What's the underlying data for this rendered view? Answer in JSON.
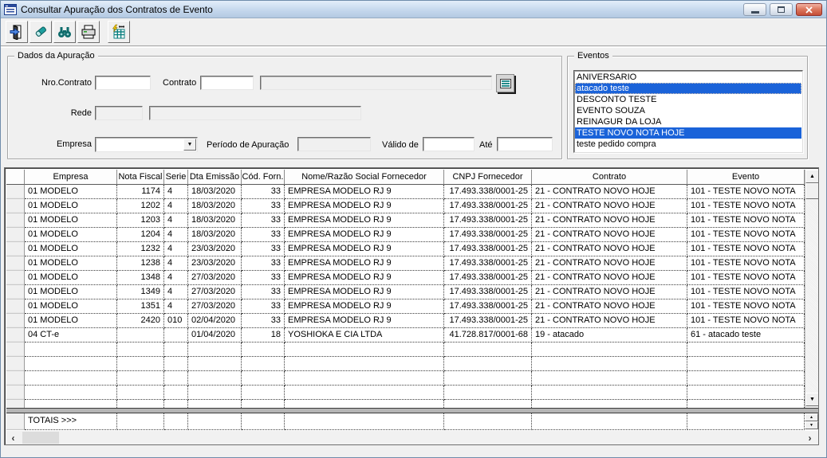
{
  "window": {
    "title": "Consultar Apuração dos Contratos de Evento",
    "controls": [
      "minimize",
      "restore",
      "close"
    ]
  },
  "toolbar": {
    "buttons": [
      {
        "name": "exit",
        "icon": "exit-door-icon"
      },
      {
        "name": "clear",
        "icon": "eraser-icon"
      },
      {
        "name": "search",
        "icon": "binoculars-icon"
      },
      {
        "name": "print",
        "icon": "printer-icon"
      },
      {
        "name": "apurar",
        "icon": "grid-lightning-icon"
      }
    ]
  },
  "filters": {
    "title": "Dados da Apuração",
    "fields": {
      "nro_contrato": {
        "label": "Nro.Contrato",
        "value": ""
      },
      "contrato_cod": {
        "label": "Contrato",
        "value": ""
      },
      "contrato_desc": {
        "value": ""
      },
      "rede_cod": {
        "label": "Rede",
        "value": ""
      },
      "rede_desc": {
        "value": ""
      },
      "empresa": {
        "label": "Empresa",
        "value": ""
      },
      "periodo": {
        "label": "Período de Apuração",
        "value": ""
      },
      "valido_de": {
        "label": "Válido de",
        "value": ""
      },
      "ate": {
        "label": "Até",
        "value": ""
      }
    }
  },
  "eventos": {
    "title": "Eventos",
    "items": [
      {
        "label": "ANIVERSARIO",
        "selected": false,
        "focused": false
      },
      {
        "label": "atacado teste",
        "selected": true,
        "focused": true
      },
      {
        "label": "DESCONTO TESTE",
        "selected": false,
        "focused": false
      },
      {
        "label": "EVENTO SOUZA",
        "selected": false,
        "focused": false
      },
      {
        "label": "REINAGUR DA LOJA",
        "selected": false,
        "focused": false
      },
      {
        "label": "TESTE NOVO NOTA HOJE",
        "selected": true,
        "focused": false
      },
      {
        "label": "teste pedido compra",
        "selected": false,
        "focused": false
      }
    ]
  },
  "grid": {
    "columns": [
      "Empresa",
      "Nota Fiscal",
      "Serie",
      "Dta Emissão",
      "Cód. Forn.",
      "Nome/Razão Social Fornecedor",
      "CNPJ Fornecedor",
      "Contrato",
      "Evento"
    ],
    "rows": [
      [
        "01 MODELO",
        "1174",
        "4",
        "18/03/2020",
        "33",
        "EMPRESA MODELO RJ 9",
        "17.493.338/0001-25",
        "21 - CONTRATO NOVO HOJE",
        "101 - TESTE NOVO NOTA"
      ],
      [
        "01 MODELO",
        "1202",
        "4",
        "18/03/2020",
        "33",
        "EMPRESA MODELO RJ 9",
        "17.493.338/0001-25",
        "21 - CONTRATO NOVO HOJE",
        "101 - TESTE NOVO NOTA"
      ],
      [
        "01 MODELO",
        "1203",
        "4",
        "18/03/2020",
        "33",
        "EMPRESA MODELO RJ 9",
        "17.493.338/0001-25",
        "21 - CONTRATO NOVO HOJE",
        "101 - TESTE NOVO NOTA"
      ],
      [
        "01 MODELO",
        "1204",
        "4",
        "18/03/2020",
        "33",
        "EMPRESA MODELO RJ 9",
        "17.493.338/0001-25",
        "21 - CONTRATO NOVO HOJE",
        "101 - TESTE NOVO NOTA"
      ],
      [
        "01 MODELO",
        "1232",
        "4",
        "23/03/2020",
        "33",
        "EMPRESA MODELO RJ 9",
        "17.493.338/0001-25",
        "21 - CONTRATO NOVO HOJE",
        "101 - TESTE NOVO NOTA"
      ],
      [
        "01 MODELO",
        "1238",
        "4",
        "23/03/2020",
        "33",
        "EMPRESA MODELO RJ 9",
        "17.493.338/0001-25",
        "21 - CONTRATO NOVO HOJE",
        "101 - TESTE NOVO NOTA"
      ],
      [
        "01 MODELO",
        "1348",
        "4",
        "27/03/2020",
        "33",
        "EMPRESA MODELO RJ 9",
        "17.493.338/0001-25",
        "21 - CONTRATO NOVO HOJE",
        "101 - TESTE NOVO NOTA"
      ],
      [
        "01 MODELO",
        "1349",
        "4",
        "27/03/2020",
        "33",
        "EMPRESA MODELO RJ 9",
        "17.493.338/0001-25",
        "21 - CONTRATO NOVO HOJE",
        "101 - TESTE NOVO NOTA"
      ],
      [
        "01 MODELO",
        "1351",
        "4",
        "27/03/2020",
        "33",
        "EMPRESA MODELO RJ 9",
        "17.493.338/0001-25",
        "21 - CONTRATO NOVO HOJE",
        "101 - TESTE NOVO NOTA"
      ],
      [
        "01 MODELO",
        "2420",
        "010",
        "02/04/2020",
        "33",
        "EMPRESA MODELO RJ 9",
        "17.493.338/0001-25",
        "21 - CONTRATO NOVO HOJE",
        "101 - TESTE NOVO NOTA"
      ],
      [
        "04 CT-e",
        "",
        "",
        "01/04/2020",
        "18",
        "YOSHIOKA E CIA LTDA",
        "41.728.817/0001-68",
        "19 - atacado",
        "61 - atacado teste"
      ]
    ],
    "totals_label": "TOTAIS >>>"
  },
  "colors": {
    "selection_blue": "#1a63d9",
    "titlebar_top": "#e3eefa",
    "titlebar_bottom": "#b3c9e2",
    "close_red": "#c44f38",
    "icon_teal": "#007a7a",
    "lightning_yellow": "#ffd400",
    "window_gray": "#f0f0f0"
  }
}
